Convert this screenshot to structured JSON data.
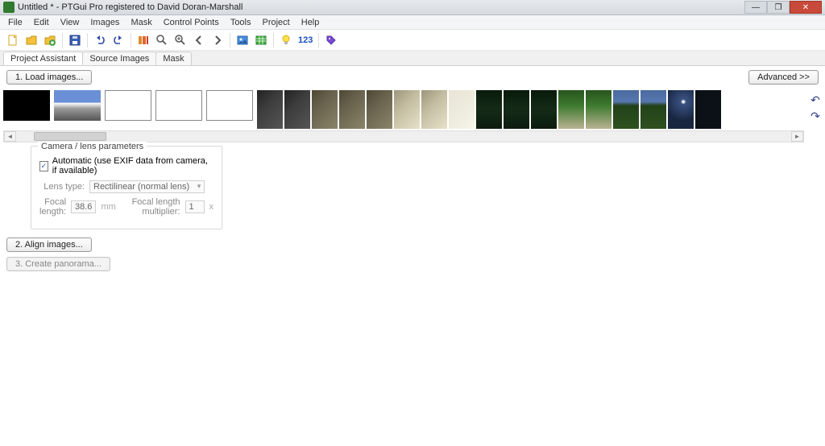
{
  "window": {
    "title": "Untitled * - PTGui Pro registered to David Doran-Marshall",
    "min_glyph": "—",
    "max_glyph": "❐",
    "close_glyph": "✕"
  },
  "menu": [
    "File",
    "Edit",
    "View",
    "Images",
    "Mask",
    "Control Points",
    "Tools",
    "Project",
    "Help"
  ],
  "toolbar": {
    "number_label": "123"
  },
  "tabs": {
    "items": [
      "Project Assistant",
      "Source Images",
      "Mask"
    ],
    "active_index": 0
  },
  "assistant": {
    "load_images_label": "1. Load images...",
    "advanced_label": "Advanced >>",
    "align_images_label": "2. Align images...",
    "create_panorama_label": "3. Create panorama..."
  },
  "camera_lens": {
    "group_title": "Camera / lens parameters",
    "auto_checkbox_label": "Automatic (use EXIF data from camera, if available)",
    "auto_checked": true,
    "lens_type_label": "Lens type:",
    "lens_type_value": "Rectilinear (normal lens)",
    "focal_length_label": "Focal length:",
    "focal_length_value": "38.6",
    "focal_length_unit": "mm",
    "multiplier_label": "Focal length multiplier:",
    "multiplier_value": "1",
    "multiplier_unit": "x"
  },
  "thumbnails": [
    {
      "cls": "black"
    },
    {
      "cls": "sky"
    },
    {
      "cls": "blank"
    },
    {
      "cls": "blank"
    },
    {
      "cls": "blank"
    },
    {
      "cls": "rockD"
    },
    {
      "cls": "rockD"
    },
    {
      "cls": "rockM"
    },
    {
      "cls": "rockM"
    },
    {
      "cls": "rockM"
    },
    {
      "cls": "rockB"
    },
    {
      "cls": "rockB"
    },
    {
      "cls": "rockW"
    },
    {
      "cls": "forD"
    },
    {
      "cls": "forD"
    },
    {
      "cls": "forD"
    },
    {
      "cls": "forM"
    },
    {
      "cls": "forM"
    },
    {
      "cls": "skyG"
    },
    {
      "cls": "skyG"
    },
    {
      "cls": "sun"
    },
    {
      "cls": "dark"
    }
  ],
  "colors": {
    "accent": "#1b4fbd"
  }
}
